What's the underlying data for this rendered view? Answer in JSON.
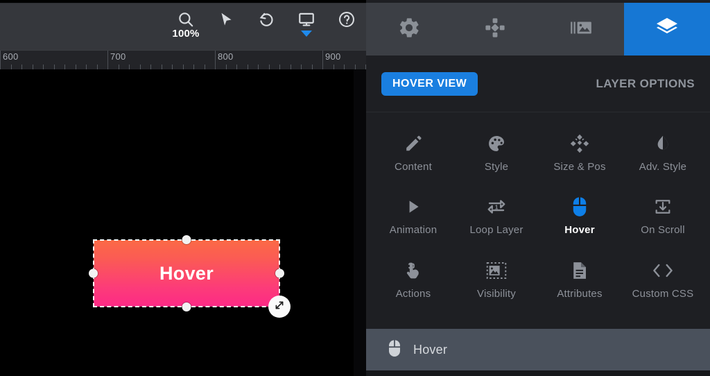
{
  "editor": {
    "toolbar": {
      "zoom": {
        "icon": "magnifier-icon",
        "value": "100%"
      },
      "select": {
        "icon": "cursor-arrow-icon",
        "label": "Select"
      },
      "undo": {
        "icon": "undo-icon",
        "label": "Undo"
      },
      "preview": {
        "icon": "monitor-icon",
        "label": "Preview Device"
      },
      "help": {
        "icon": "help-circle-icon",
        "label": "Help"
      }
    },
    "ruler": {
      "unit": "px",
      "labels": [
        "600",
        "700",
        "800",
        "900"
      ],
      "major_positions": [
        0,
        155,
        310,
        465
      ],
      "minor_step": 15.5
    },
    "canvas": {
      "background": "#000000",
      "layer": {
        "text": "Hover",
        "gradient_from": "#fb6a46",
        "gradient_to": "#fd2a86",
        "selected": true,
        "handles": [
          "top",
          "right",
          "bottom",
          "left"
        ],
        "resize_handle_icon": "resize-diagonal-icon"
      }
    }
  },
  "panel": {
    "tabs": [
      {
        "name": "settings",
        "icon": "gear-icon",
        "active": false
      },
      {
        "name": "navigation",
        "icon": "move-plus-icon",
        "active": false
      },
      {
        "name": "slides",
        "icon": "slides-image-icon",
        "active": false
      },
      {
        "name": "layers",
        "icon": "layers-icon",
        "active": true
      }
    ],
    "header": {
      "view_button": "HOVER VIEW",
      "title": "LAYER OPTIONS",
      "accent_color": "#1a7fe0"
    },
    "options": [
      {
        "label": "Content",
        "icon": "pencil-icon",
        "active": false
      },
      {
        "label": "Style",
        "icon": "palette-icon",
        "active": false
      },
      {
        "label": "Size & Pos",
        "icon": "move-arrows-icon",
        "active": false
      },
      {
        "label": "Adv. Style",
        "icon": "contrast-drop-icon",
        "active": false
      },
      {
        "label": "Animation",
        "icon": "play-icon",
        "active": false
      },
      {
        "label": "Loop Layer",
        "icon": "repeat-one-icon",
        "active": false
      },
      {
        "label": "Hover",
        "icon": "mouse-icon",
        "active": true
      },
      {
        "label": "On Scroll",
        "icon": "download-box-icon",
        "active": false
      },
      {
        "label": "Actions",
        "icon": "tap-hand-icon",
        "active": false
      },
      {
        "label": "Visibility",
        "icon": "image-dashed-icon",
        "active": false
      },
      {
        "label": "Attributes",
        "icon": "document-icon",
        "active": false
      },
      {
        "label": "Custom CSS",
        "icon": "code-brackets-icon",
        "active": false
      }
    ],
    "footer": {
      "icon": "mouse-icon",
      "label": "Hover"
    }
  }
}
